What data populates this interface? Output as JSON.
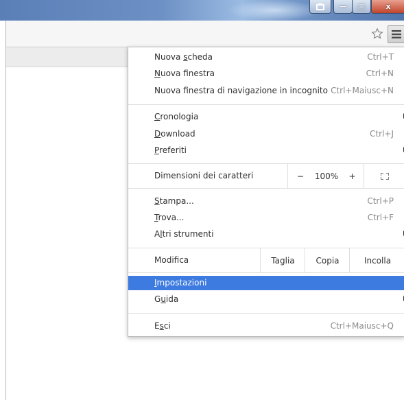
{
  "window": {
    "minimize_glyph": "—",
    "maximize_glyph": "□",
    "close_glyph": "x"
  },
  "toolbar": {
    "star_icon": "star-icon",
    "menu_icon": "hamburger-icon"
  },
  "menu": {
    "new_tab": {
      "pre": "Nuova ",
      "ul": "s",
      "post": "cheda",
      "shortcut": "Ctrl+T"
    },
    "new_window": {
      "pre": "",
      "ul": "N",
      "post": "uova finestra",
      "shortcut": "Ctrl+N"
    },
    "incognito": {
      "pre": "Nuova f",
      "ul": "i",
      "post": "nestra di navigazione in incognito",
      "shortcut": "Ctrl+Maiusc+N"
    },
    "history": {
      "pre": "",
      "ul": "C",
      "post": "ronologia"
    },
    "downloads": {
      "pre": "",
      "ul": "D",
      "post": "ownload",
      "shortcut": "Ctrl+J"
    },
    "bookmarks": {
      "pre": "",
      "ul": "P",
      "post": "referiti"
    },
    "zoom": {
      "label": "Dimensioni dei caratteri",
      "minus": "−",
      "value": "100%",
      "plus": "+"
    },
    "print": {
      "pre": "",
      "ul": "S",
      "post": "tampa...",
      "shortcut": "Ctrl+P"
    },
    "find": {
      "pre": "",
      "ul": "T",
      "post": "rova...",
      "shortcut": "Ctrl+F"
    },
    "more_tools": {
      "pre": "A",
      "ul": "l",
      "post": "tri strumenti"
    },
    "edit": {
      "label": "Modifica",
      "cut": "Taglia",
      "copy": "Copia",
      "paste": "Incolla"
    },
    "settings": {
      "pre": "",
      "ul": "I",
      "post": "mpostazioni"
    },
    "help": {
      "pre": "G",
      "ul": "u",
      "post": "ida"
    },
    "exit": {
      "pre": "E",
      "ul": "s",
      "post": "ci",
      "shortcut": "Ctrl+Maiusc+Q"
    }
  },
  "colors": {
    "highlight": "#3d7be0",
    "shortcut_text": "#8a8a8a"
  }
}
